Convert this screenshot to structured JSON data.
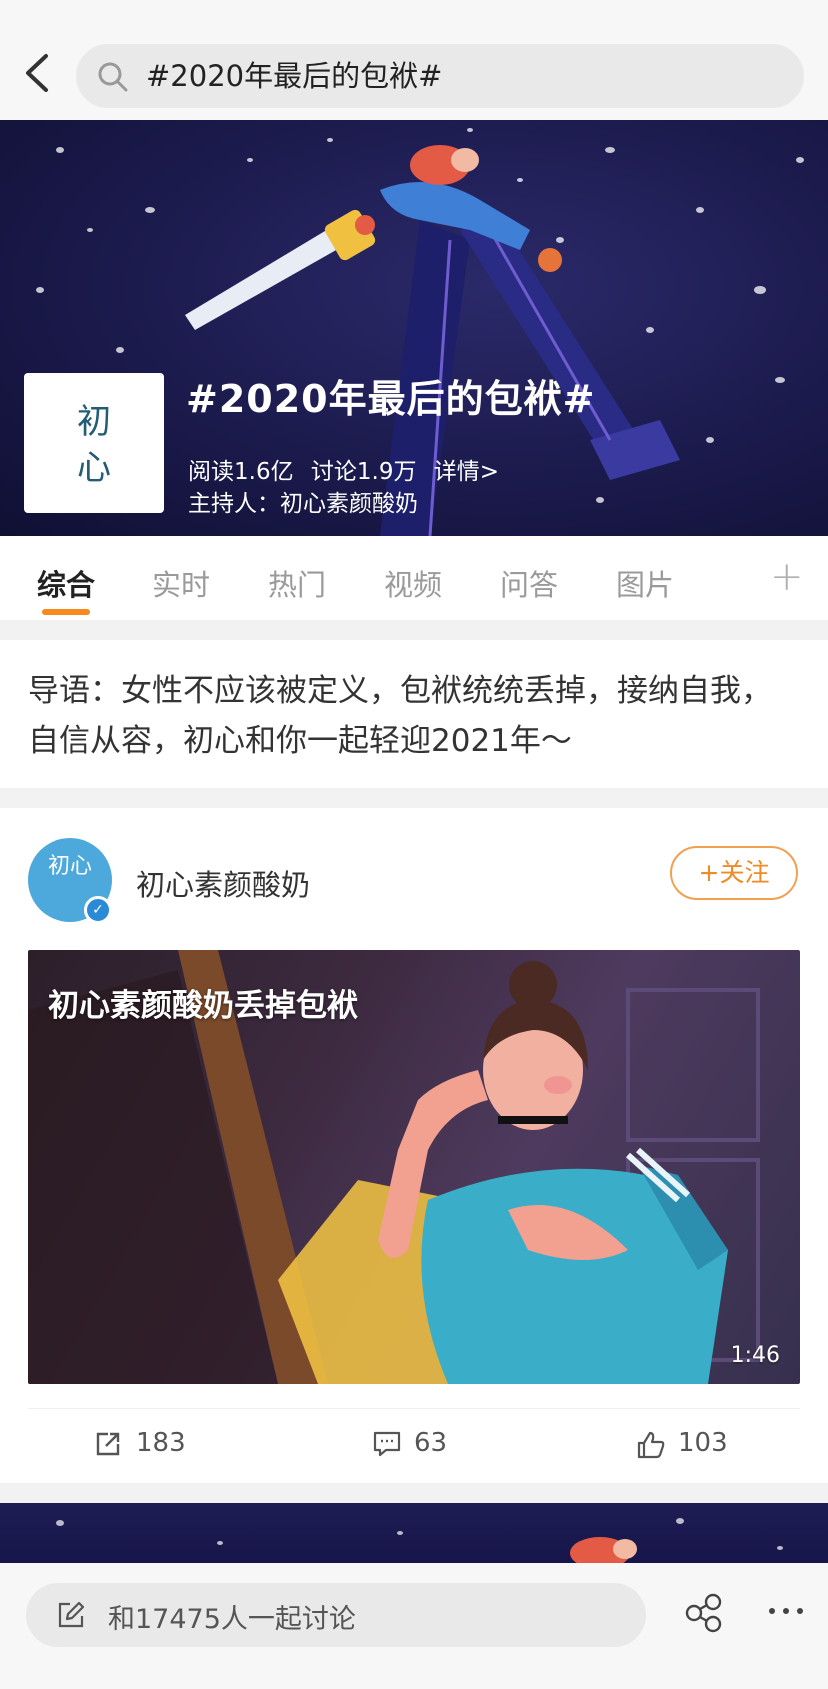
{
  "search": {
    "query": "#2020年最后的包袱#"
  },
  "topic": {
    "title": "#2020年最后的包袱#",
    "reads": "阅读1.6亿",
    "discussions": "讨论1.9万",
    "details": "详情>",
    "host": "主持人：初心素颜酸奶",
    "logo_text": "初\n心"
  },
  "tabs": [
    {
      "label": "综合",
      "active": true
    },
    {
      "label": "实时"
    },
    {
      "label": "热门"
    },
    {
      "label": "视频"
    },
    {
      "label": "问答"
    },
    {
      "label": "图片"
    }
  ],
  "intro": "导语：女性不应该被定义，包袱统统丢掉，接纳自我，自信从容，初心和你一起轻迎2021年～",
  "post": {
    "author": "初心素颜酸奶",
    "avatar_text": "初心",
    "follow_label": "+关注",
    "video_title": "初心素颜酸奶丢掉包袱",
    "duration": "1:46",
    "reposts": "183",
    "comments": "63",
    "likes": "103"
  },
  "bottom": {
    "placeholder": "和17475人一起讨论"
  },
  "colors": {
    "accent": "#f7891e",
    "banner_bg": "#1b1a4c",
    "verified": "#2b8ad8"
  }
}
